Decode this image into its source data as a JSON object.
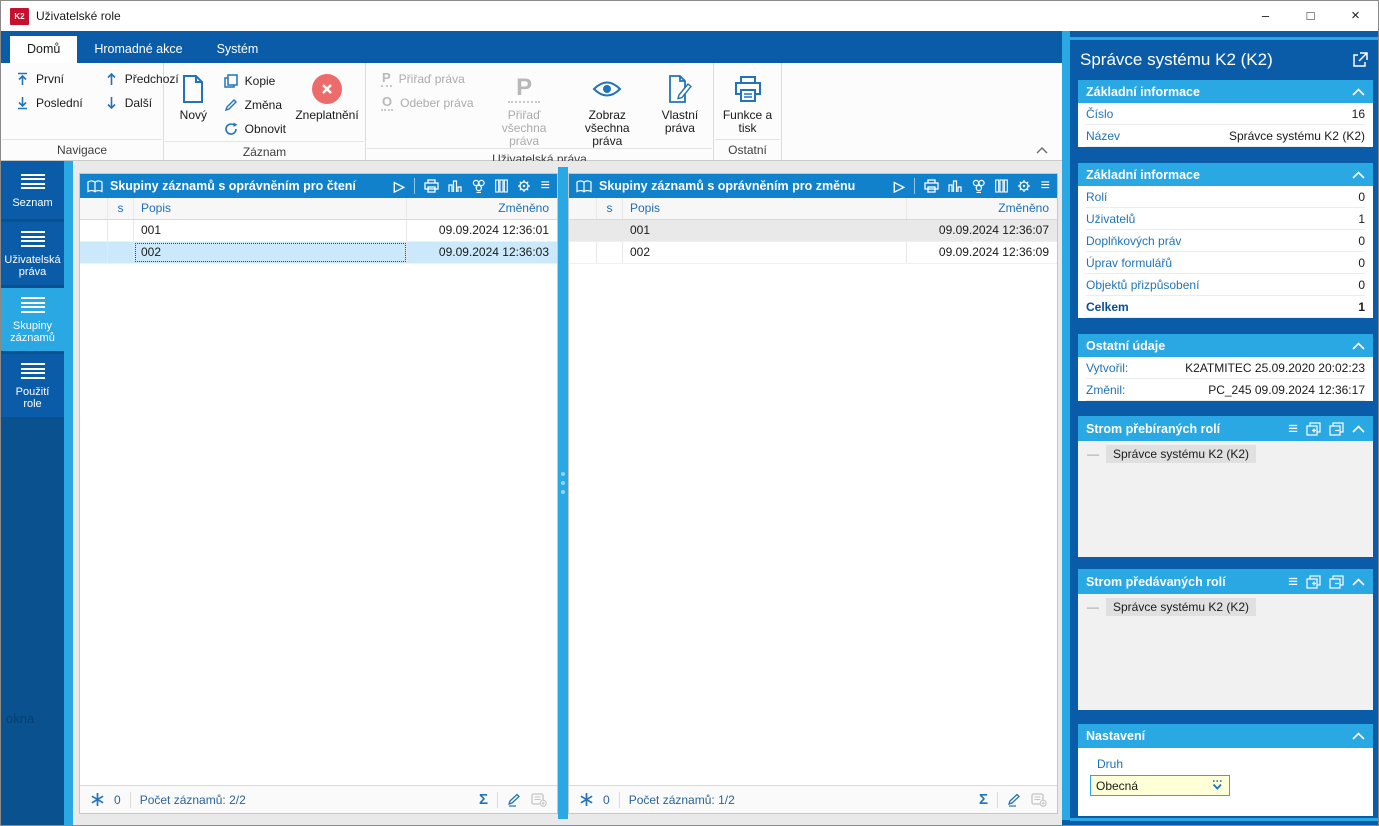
{
  "window": {
    "title": "Uživatelské role",
    "logo": "K2",
    "minimize": "–",
    "maximize": "□",
    "close": "×"
  },
  "glyphs": {
    "play": "▷",
    "menu": "≡",
    "sigma": "Σ",
    "collapse": "∧",
    "dash": "—",
    "p": "P",
    "o": "O"
  },
  "colors": {
    "accent_dark": "#0A5CA8",
    "accent_cyan": "#29A8E3",
    "grid_header": "#1181CB",
    "selection": "#CBE9FA",
    "invalid_red": "#EE6B6B",
    "dropdown_bg": "#FFFFD8"
  },
  "ribbon": {
    "tabs": [
      "Domů",
      "Hromadné akce",
      "Systém"
    ],
    "active_tab": "Domů",
    "nav": {
      "first": "První",
      "previous": "Předchozí",
      "last": "Poslední",
      "next": "Další",
      "group": "Navigace"
    },
    "record": {
      "new": "Nový",
      "copy": "Kopie",
      "change": "Změna",
      "refresh": "Obnovit",
      "invalidate": "Zneplatnění",
      "group": "Záznam"
    },
    "rights": {
      "assign": "Přiřaď práva",
      "remove": "Odeber práva",
      "assign_all_1": "Přiřaď",
      "assign_all_2": "všechna práva",
      "show_all_1": "Zobraz",
      "show_all_2": "všechna práva",
      "own_1": "Vlastní",
      "own_2": "práva",
      "group": "Uživatelská práva"
    },
    "other": {
      "func_1": "Funkce a",
      "func_2": "tisk",
      "group": "Ostatní"
    }
  },
  "sidebar": {
    "items": [
      {
        "label": "Seznam"
      },
      {
        "label_1": "Uživatelská",
        "label_2": "práva"
      },
      {
        "label_1": "Skupiny",
        "label_2": "záznamů",
        "active": true
      },
      {
        "label_1": "Použití",
        "label_2": "role"
      }
    ],
    "ghost_text": "okna"
  },
  "grids": [
    {
      "title": "Skupiny záznamů s oprávněním pro čtení",
      "columns": [
        "s",
        "Popis",
        "Změněno"
      ],
      "rows": [
        {
          "popis": "001",
          "zmeneno": "09.09.2024 12:36:01"
        },
        {
          "popis": "002",
          "zmeneno": "09.09.2024 12:36:03",
          "state": "selected"
        }
      ],
      "status": {
        "star_count": "0",
        "records": "Počet záznamů: 2/2"
      }
    },
    {
      "title": "Skupiny záznamů s oprávněním pro změnu",
      "columns": [
        "s",
        "Popis",
        "Změněno"
      ],
      "rows": [
        {
          "popis": "001",
          "zmeneno": "09.09.2024 12:36:07",
          "state": "alt"
        },
        {
          "popis": "002",
          "zmeneno": "09.09.2024 12:36:09"
        }
      ],
      "status": {
        "star_count": "0",
        "records": "Počet záznamů: 1/2"
      }
    }
  ],
  "panel": {
    "title": "Správce systému K2 (K2)",
    "sections": [
      {
        "title": "Základní informace",
        "rows": [
          {
            "label": "Číslo",
            "value": "16"
          },
          {
            "label": "Název",
            "value": "Správce systému K2 (K2)"
          }
        ]
      },
      {
        "title": "Základní informace",
        "rows": [
          {
            "label": "Rolí",
            "value": "0"
          },
          {
            "label": "Uživatelů",
            "value": "1"
          },
          {
            "label": "Doplňkových práv",
            "value": "0"
          },
          {
            "label": "Úprav formulářů",
            "value": "0"
          },
          {
            "label": "Objektů přizpůsobení",
            "value": "0"
          },
          {
            "label": "Celkem",
            "value": "1"
          }
        ]
      },
      {
        "title": "Ostatní údaje",
        "rows": [
          {
            "label": "Vytvořil:",
            "value": "K2ATMITEC 25.09.2020 20:02:23"
          },
          {
            "label": "Změnil:",
            "value": "PC_245 09.09.2024 12:36:17"
          }
        ]
      }
    ],
    "trees": [
      {
        "title": "Strom přebíraných rolí",
        "items": [
          "Správce systému K2 (K2)"
        ]
      },
      {
        "title": "Strom předávaných rolí",
        "items": [
          "Správce systému K2 (K2)"
        ]
      }
    ],
    "settings": {
      "title": "Nastavení",
      "field_label": "Druh",
      "field_value": "Obecná"
    }
  }
}
